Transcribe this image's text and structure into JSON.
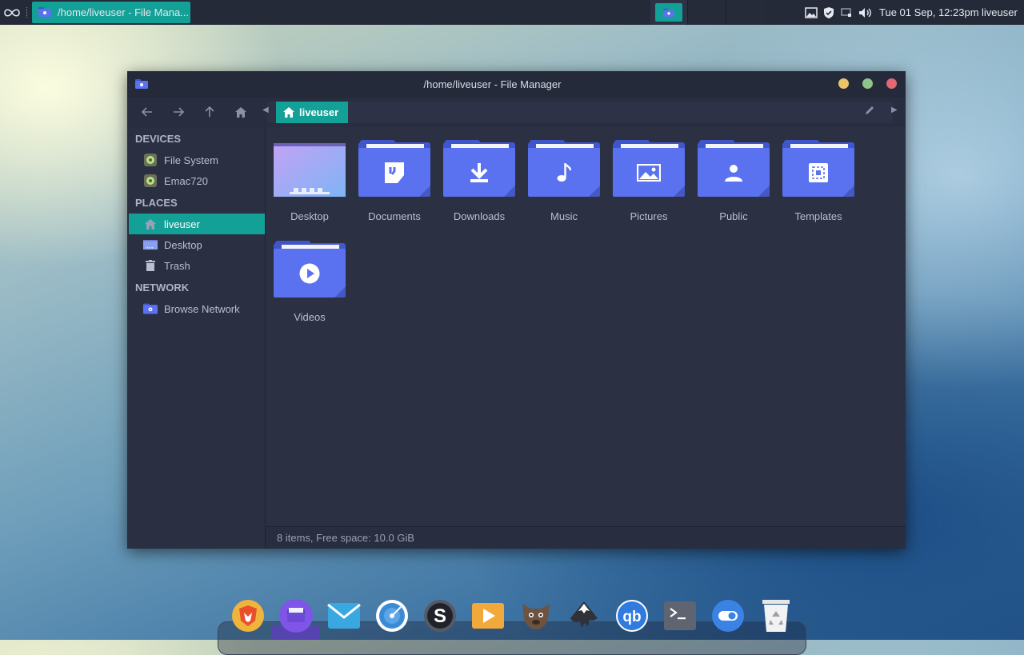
{
  "top_panel": {
    "task_title": "/home/liveuser - File Mana...",
    "clock": "Tue 01 Sep, 12:23pm",
    "user": "liveuser",
    "tray_icons": [
      "image-icon",
      "shield-icon",
      "network-icon",
      "volume-icon"
    ]
  },
  "window": {
    "title": "/home/liveuser - File Manager",
    "breadcrumb": "liveuser",
    "button_colors": {
      "minimize": "#e9c46a",
      "maximize": "#8fc48a",
      "close": "#e36872"
    }
  },
  "sidebar": {
    "devices_label": "DEVICES",
    "devices": [
      {
        "label": "File System"
      },
      {
        "label": "Emac720"
      }
    ],
    "places_label": "PLACES",
    "places": [
      {
        "label": "liveuser"
      },
      {
        "label": "Desktop"
      },
      {
        "label": "Trash"
      }
    ],
    "network_label": "NETWORK",
    "network": [
      {
        "label": "Browse Network"
      }
    ]
  },
  "files": [
    {
      "name": "Desktop",
      "icon": "desktop-folder"
    },
    {
      "name": "Documents",
      "icon": "document"
    },
    {
      "name": "Downloads",
      "icon": "download"
    },
    {
      "name": "Music",
      "icon": "music"
    },
    {
      "name": "Pictures",
      "icon": "image"
    },
    {
      "name": "Public",
      "icon": "person"
    },
    {
      "name": "Templates",
      "icon": "template"
    },
    {
      "name": "Videos",
      "icon": "play"
    }
  ],
  "status": "8 items, Free space: 10.0 GiB",
  "dock": [
    "brave",
    "files",
    "mail",
    "disc",
    "s-app",
    "media-player",
    "gimp",
    "inkscape",
    "qbittorrent",
    "terminal",
    "toggle",
    "trash"
  ],
  "colors": {
    "accent": "#12a097",
    "folder": "#5b72f0",
    "panel": "#252a38",
    "window": "#2b3043"
  }
}
